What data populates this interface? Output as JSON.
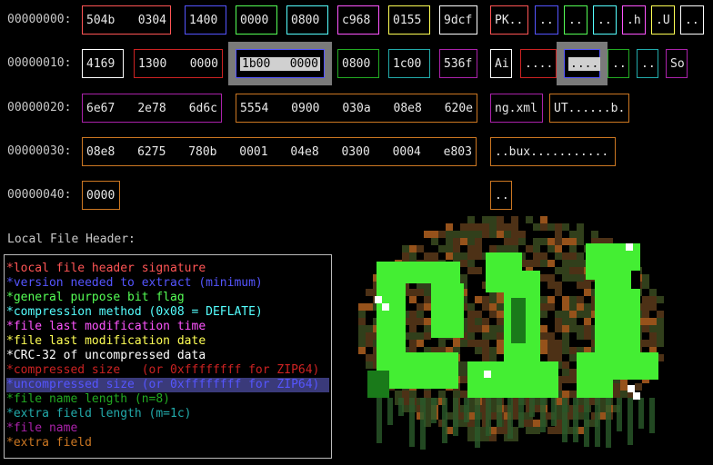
{
  "rows": [
    {
      "address": "00000000:",
      "hex": [
        {
          "words": [
            "504b",
            "0304"
          ],
          "color": "#ff5555"
        },
        {
          "words": [
            "1400"
          ],
          "color": "#5555ff"
        },
        {
          "words": [
            "0000"
          ],
          "color": "#55ff55"
        },
        {
          "words": [
            "0800"
          ],
          "color": "#55ffff"
        },
        {
          "words": [
            "c968"
          ],
          "color": "#ff55ff"
        },
        {
          "words": [
            "0155"
          ],
          "color": "#ffff55"
        },
        {
          "words": [
            "9dcf"
          ],
          "color": "#ffffff"
        }
      ],
      "ascii": [
        {
          "text": "PK..",
          "color": "#ff5555"
        },
        {
          "text": "..",
          "color": "#5555ff"
        },
        {
          "text": "..",
          "color": "#55ff55"
        },
        {
          "text": "..",
          "color": "#55ffff"
        },
        {
          "text": ".h",
          "color": "#ff55ff"
        },
        {
          "text": ".U",
          "color": "#ffff55"
        },
        {
          "text": "..",
          "color": "#ffffff"
        }
      ]
    },
    {
      "address": "00000010:",
      "hex": [
        {
          "words": [
            "4169"
          ],
          "color": "#ffffff"
        },
        {
          "words": [
            "1300",
            "0000"
          ],
          "color": "#cc2222"
        },
        {
          "words": [
            "1b00",
            "0000"
          ],
          "color": "#5555ff",
          "selected": true
        },
        {
          "words": [
            "0800"
          ],
          "color": "#22aa22"
        },
        {
          "words": [
            "1c00"
          ],
          "color": "#22aaaa"
        },
        {
          "words": [
            "536f"
          ],
          "color": "#aa22aa"
        }
      ],
      "ascii": [
        {
          "text": "Ai",
          "color": "#ffffff"
        },
        {
          "text": "....",
          "color": "#cc2222"
        },
        {
          "text": "....",
          "color": "#5555ff",
          "selected": true
        },
        {
          "text": "..",
          "color": "#22aa22"
        },
        {
          "text": "..",
          "color": "#22aaaa"
        },
        {
          "text": "So",
          "color": "#aa22aa"
        }
      ]
    },
    {
      "address": "00000020:",
      "hex": [
        {
          "words": [
            "6e67",
            "2e78",
            "6d6c"
          ],
          "color": "#aa22aa"
        },
        {
          "words": [
            "5554",
            "0900",
            "030a",
            "08e8",
            "620e"
          ],
          "color": "#cc7722"
        }
      ],
      "ascii": [
        {
          "text": "ng.xml",
          "color": "#aa22aa"
        },
        {
          "text": "UT......b.",
          "color": "#cc7722"
        }
      ]
    },
    {
      "address": "00000030:",
      "hex": [
        {
          "words": [
            "08e8",
            "6275",
            "780b",
            "0001",
            "04e8",
            "0300",
            "0004",
            "e803"
          ],
          "color": "#cc7722"
        }
      ],
      "ascii": [
        {
          "text": "..bux...........",
          "color": "#cc7722"
        }
      ]
    },
    {
      "address": "00000040:",
      "hex": [
        {
          "words": [
            "0000"
          ],
          "color": "#cc7722"
        }
      ],
      "ascii": [
        {
          "text": "..",
          "color": "#cc7722"
        }
      ]
    }
  ],
  "legend_title": "Local File Header:",
  "legend": [
    {
      "text": "*local file header signature",
      "color": "#ff5555"
    },
    {
      "text": "*version needed to extract (minimum)",
      "color": "#5555ff"
    },
    {
      "text": "*general purpose bit flag",
      "color": "#55ff55"
    },
    {
      "text": "*compression method (0x08 = DEFLATE)",
      "color": "#55ffff"
    },
    {
      "text": "*file last modification time",
      "color": "#ff55ff"
    },
    {
      "text": "*file last modification date",
      "color": "#ffff55"
    },
    {
      "text": "*CRC-32 of uncompressed data",
      "color": "#ffffff"
    },
    {
      "text": "*compressed size   (or 0xffffffff for ZIP64)",
      "color": "#cc2222"
    },
    {
      "text": "*uncompressed size (or 0xffffffff for ZIP64)",
      "color": "#5555ff",
      "highlight": true
    },
    {
      "text": "*file name length (n=8)",
      "color": "#22aa22"
    },
    {
      "text": "*extra field length (m=1c)",
      "color": "#22aaaa"
    },
    {
      "text": "*file name",
      "color": "#aa22aa"
    },
    {
      "text": "*extra field",
      "color": "#cc7722"
    }
  ],
  "art_icon": "pixel-art-zip-logo-icon"
}
